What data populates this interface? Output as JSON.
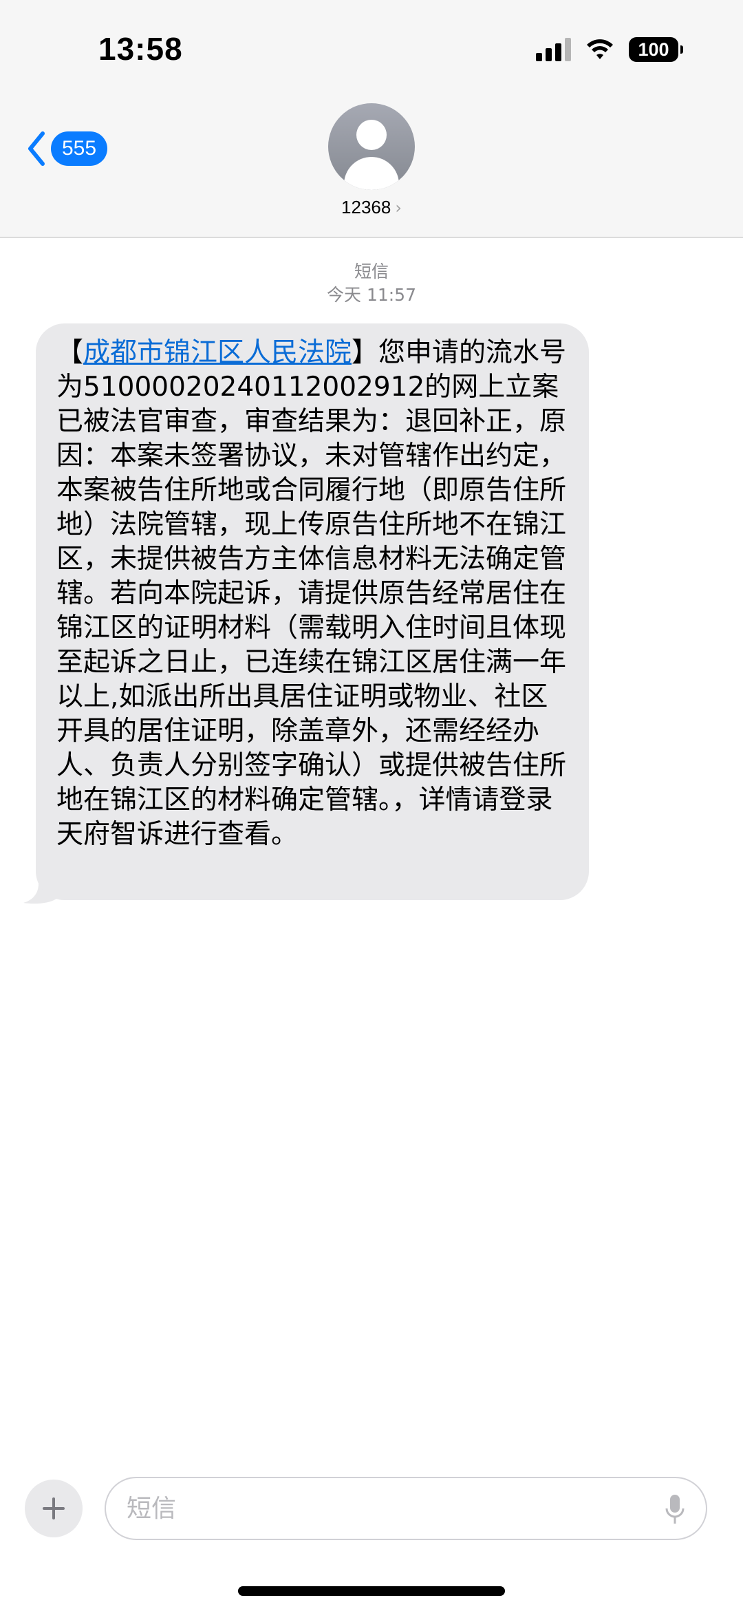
{
  "status_bar": {
    "time": "13:58",
    "battery": "100"
  },
  "nav": {
    "back_count": "555",
    "contact_number": "12368",
    "contact_chevron": "›"
  },
  "thread": {
    "message_type": "短信",
    "timestamp": "今天 11:57"
  },
  "message": {
    "bracket_open": "【",
    "sender_link": "成都市锦江区人民法院",
    "body": "】您申请的流水号为510000202401120029​12的网上立案已被法官审查，审查结果为：退回补正，原因：本案未签署协议，未对管辖作出约定，本案被告住所地或合同履行地（即原告住所地）法院管辖，现上传原告住所地不在锦江区，未提供被告方主体信息材料无法确定管辖。若向本院起诉，请提供原告经常居住在锦江区的证明材料（需载明入住时间且体现至起诉之日止，已连续在锦江区居住满一年以上,如派出所出具居住证明或物业、社区开具的居住证明，除盖章外，还需经经办人、负责人分别签字确认）或提供被告住所地在锦江区的材料确定管辖。，详情请登录天府智诉进行查看。"
  },
  "composer": {
    "placeholder": "短信"
  },
  "colors": {
    "accent": "#0a7cff",
    "bubble": "#e9e9eb",
    "header_bg": "#f6f6f6"
  }
}
